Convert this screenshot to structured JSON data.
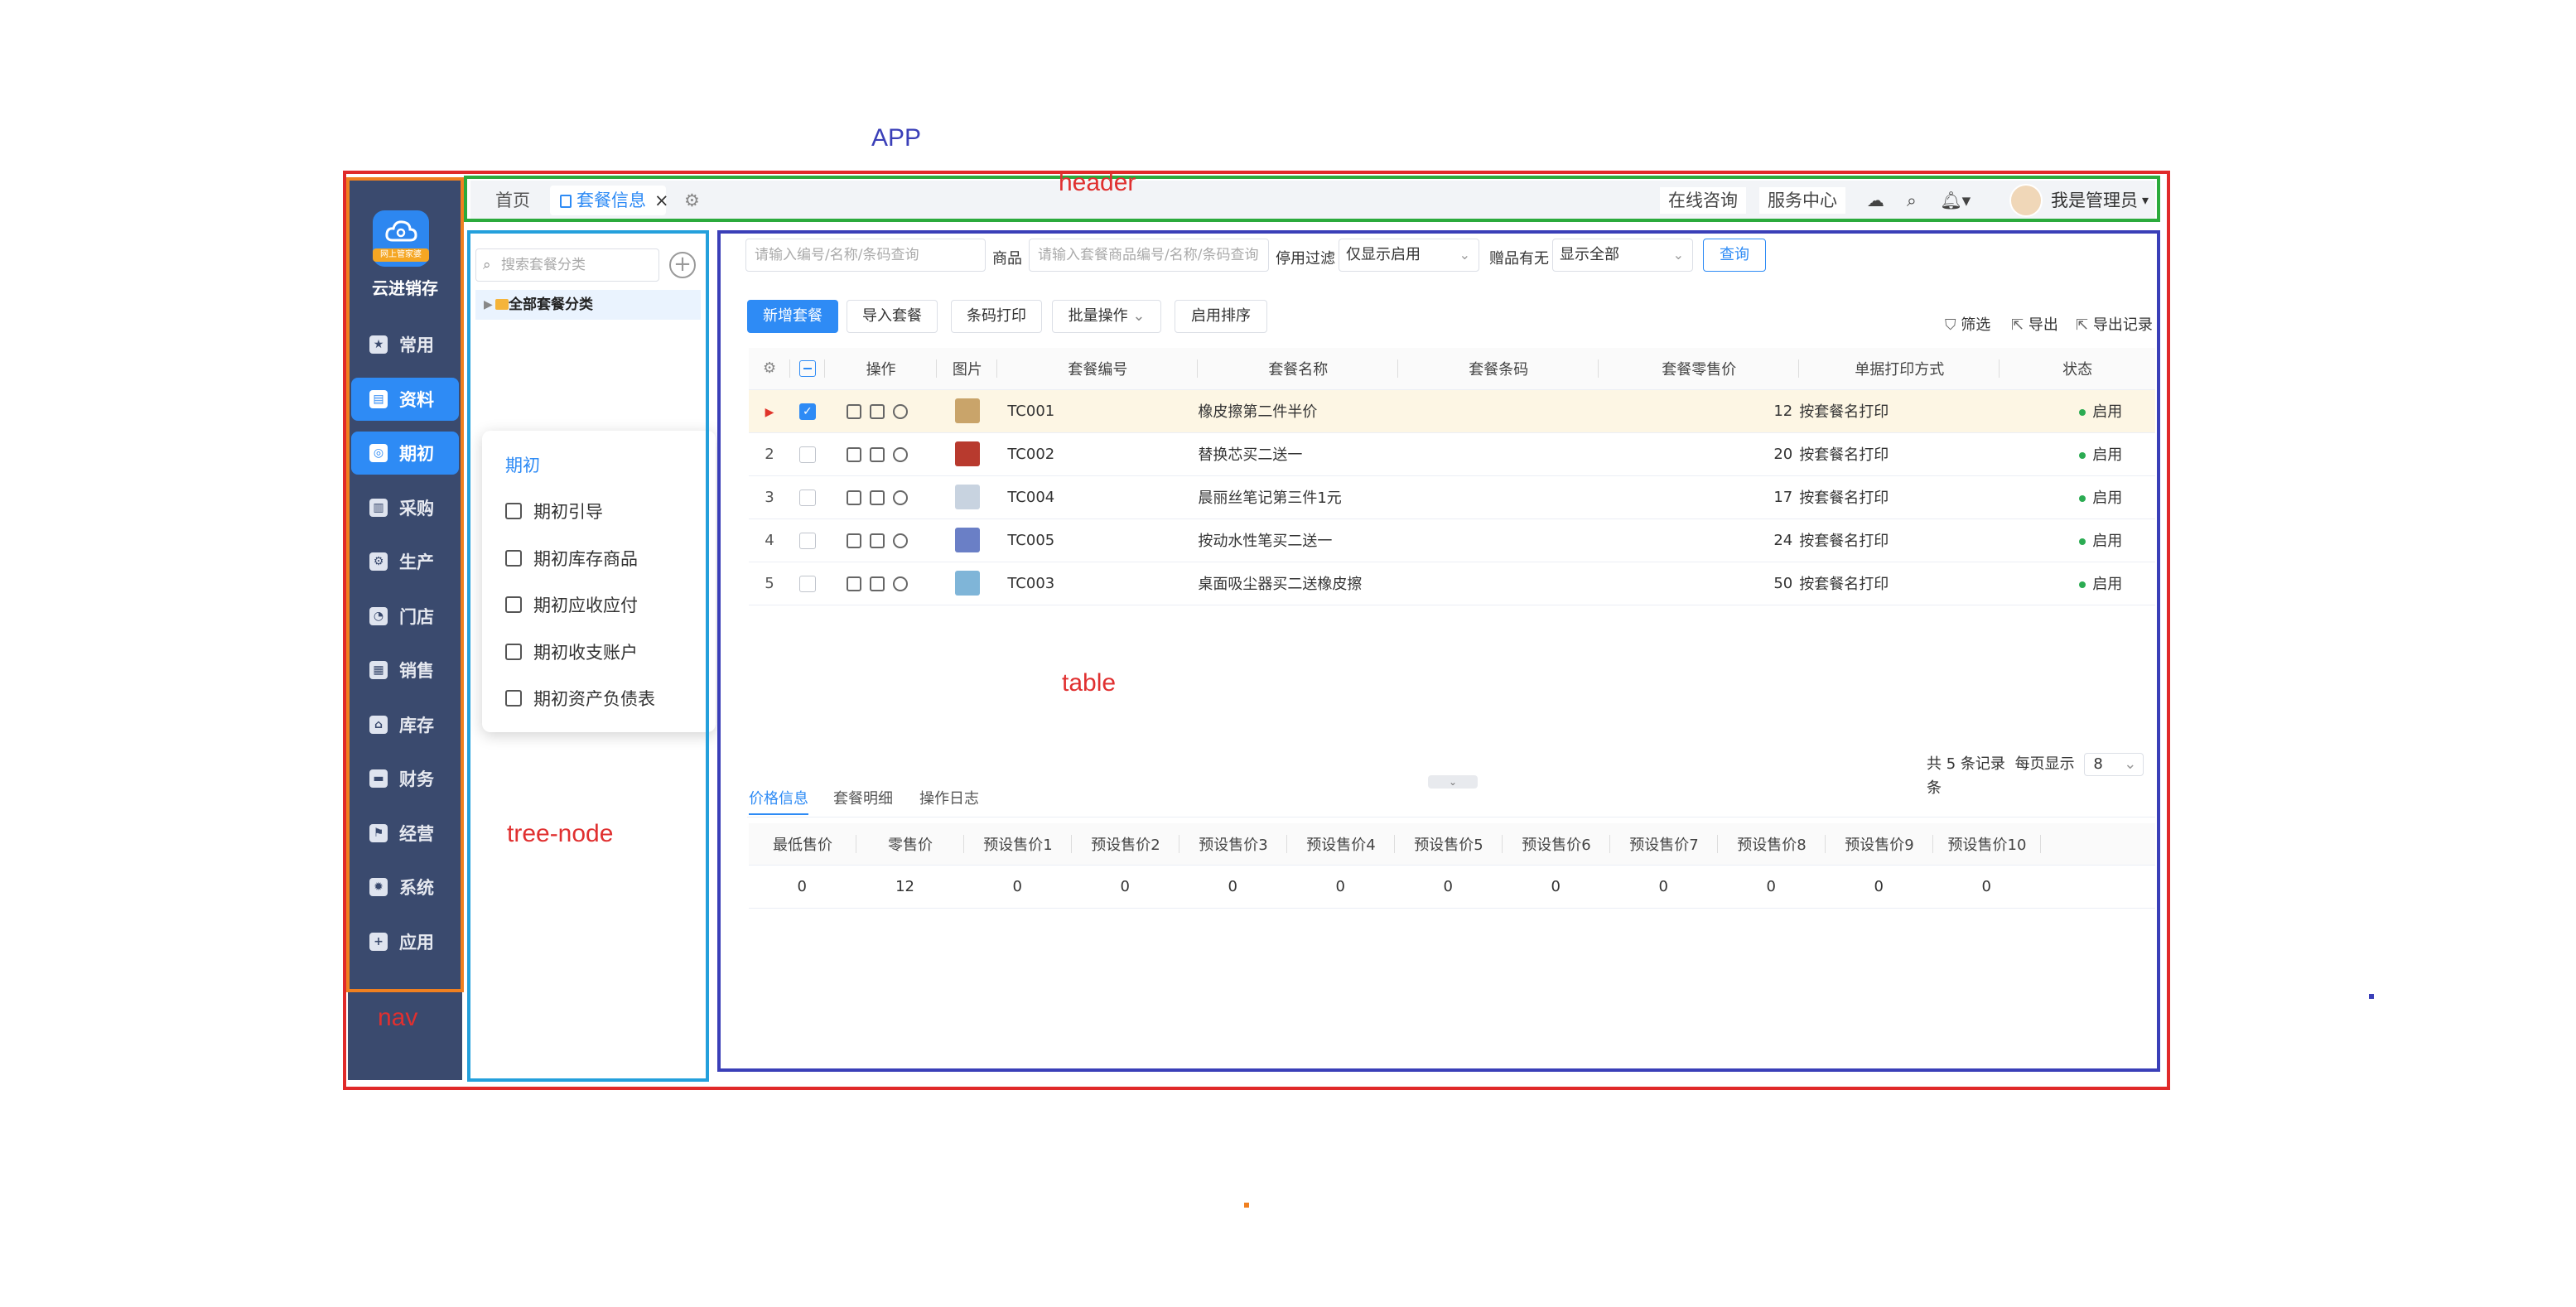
{
  "annotations": {
    "app": "APP",
    "header": "header",
    "table": "table",
    "tree_node": "tree-node",
    "nav": "nav"
  },
  "nav": {
    "brand": "云进销存",
    "logo_band": "网上管家婆",
    "items": [
      {
        "label": "常用",
        "icon": "star-icon",
        "active": false
      },
      {
        "label": "资料",
        "icon": "id-card-icon",
        "active": true
      },
      {
        "label": "期初",
        "icon": "target-icon",
        "active": true
      },
      {
        "label": "采购",
        "icon": "building-icon",
        "active": false
      },
      {
        "label": "生产",
        "icon": "gear-doc-icon",
        "active": false
      },
      {
        "label": "门店",
        "icon": "pie-icon",
        "active": false
      },
      {
        "label": "销售",
        "icon": "chart-icon",
        "active": false
      },
      {
        "label": "库存",
        "icon": "house-icon",
        "active": false
      },
      {
        "label": "财务",
        "icon": "wallet-icon",
        "active": false
      },
      {
        "label": "经营",
        "icon": "flag-icon",
        "active": false
      },
      {
        "label": "系统",
        "icon": "settings-icon",
        "active": false
      },
      {
        "label": "应用",
        "icon": "plus-box-icon",
        "active": false
      }
    ]
  },
  "header": {
    "tabs": [
      "首页",
      "套餐信息"
    ],
    "close": "×",
    "consult": "在线咨询",
    "service": "服务中心",
    "user": "我是管理员"
  },
  "tree": {
    "search_placeholder": "搜索套餐分类",
    "root": "全部套餐分类"
  },
  "popup": {
    "title": "期初",
    "items": [
      "期初引导",
      "期初库存商品",
      "期初应收应付",
      "期初收支账户",
      "期初资产负债表"
    ]
  },
  "filters": {
    "code_placeholder": "请输入编号/名称/条码查询",
    "goods_label": "商品",
    "goods_placeholder": "请输入套餐商品编号/名称/条码查询",
    "stop_label": "停用过滤",
    "stop_value": "仅显示启用",
    "gift_label": "赠品有无",
    "gift_value": "显示全部",
    "query": "查询"
  },
  "toolbar": {
    "add": "新增套餐",
    "import": "导入套餐",
    "barcode": "条码打印",
    "batch": "批量操作",
    "sort": "启用排序",
    "filter": "筛选",
    "export": "导出",
    "export_log": "导出记录"
  },
  "table": {
    "columns": [
      "操作",
      "图片",
      "套餐编号",
      "套餐名称",
      "套餐条码",
      "套餐零售价",
      "单据打印方式",
      "状态"
    ],
    "rows": [
      {
        "no": "",
        "checked": true,
        "code": "TC001",
        "name": "橡皮擦第二件半价",
        "barcode": "",
        "price": "12",
        "print": "按套餐名打印",
        "status": "启用",
        "thumb": "#c9a46a"
      },
      {
        "no": "2",
        "checked": false,
        "code": "TC002",
        "name": "替换芯买二送一",
        "barcode": "",
        "price": "20",
        "print": "按套餐名打印",
        "status": "启用",
        "thumb": "#b83a2e"
      },
      {
        "no": "3",
        "checked": false,
        "code": "TC004",
        "name": "晨丽丝笔记第三件1元",
        "barcode": "",
        "price": "17",
        "print": "按套餐名打印",
        "status": "启用",
        "thumb": "#c8d3e0"
      },
      {
        "no": "4",
        "checked": false,
        "code": "TC005",
        "name": "按动水性笔买二送一",
        "barcode": "",
        "price": "24",
        "print": "按套餐名打印",
        "status": "启用",
        "thumb": "#6a7fc6"
      },
      {
        "no": "5",
        "checked": false,
        "code": "TC003",
        "name": "桌面吸尘器买二送橡皮擦",
        "barcode": "",
        "price": "50",
        "print": "按套餐名打印",
        "status": "启用",
        "thumb": "#7fb5d8"
      }
    ]
  },
  "pager": {
    "total": "共 5 条记录",
    "per_page_label": "每页显示",
    "per_page": "8",
    "unit": "条"
  },
  "detail": {
    "tabs": [
      "价格信息",
      "套餐明细",
      "操作日志"
    ],
    "columns": [
      "最低售价",
      "零售价",
      "预设售价1",
      "预设售价2",
      "预设售价3",
      "预设售价4",
      "预设售价5",
      "预设售价6",
      "预设售价7",
      "预设售价8",
      "预设售价9",
      "预设售价10"
    ],
    "values": [
      "0",
      "12",
      "0",
      "0",
      "0",
      "0",
      "0",
      "0",
      "0",
      "0",
      "0",
      "0"
    ]
  }
}
